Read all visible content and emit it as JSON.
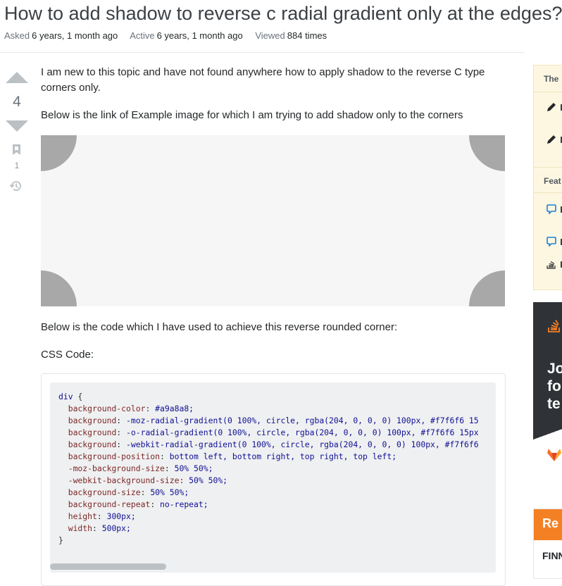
{
  "question": {
    "title": "How to add shadow to reverse c radial gradient only at the edges?",
    "asked_label": "Asked",
    "asked_value": "6 years, 1 month ago",
    "active_label": "Active",
    "active_value": "6 years, 1 month ago",
    "viewed_label": "Viewed",
    "viewed_value": "884 times"
  },
  "votes": {
    "score": "4",
    "bookmarks": "1"
  },
  "body": {
    "para1": "I am new to this topic and have not found anywhere how to apply shadow to the reverse C type corners only.",
    "para2": "Below is the link of Example image for which I am trying to add shadow only to the corners",
    "para3": "Below is the code which I have used to achieve this reverse rounded corner:",
    "para4": "CSS Code:"
  },
  "code_lines": [
    {
      "sel": "div",
      "tail": " {"
    },
    {
      "prop": "background-color",
      "val": "#a9a8a8;"
    },
    {
      "prop": "background",
      "val": "-moz-radial-gradient(0 100%, circle, rgba(204, 0, 0, 0) 100px, #f7f6f6 15"
    },
    {
      "prop": "background",
      "val": "-o-radial-gradient(0 100%, circle, rgba(204, 0, 0, 0) 100px, #f7f6f6 15px"
    },
    {
      "prop": "background",
      "val": "-webkit-radial-gradient(0 100%, circle, rgba(204, 0, 0, 0) 100px, #f7f6f6"
    },
    {
      "prop": "background-position",
      "val": "bottom left, bottom right, top right, top left;"
    },
    {
      "prop": "-moz-background-size",
      "val": "50% 50%;"
    },
    {
      "prop": "-webkit-background-size",
      "val": "50% 50%;"
    },
    {
      "prop": "background-size",
      "val": "50% 50%;"
    },
    {
      "prop": "background-repeat",
      "val": "no-repeat;"
    },
    {
      "prop": "height",
      "val": "300px;"
    },
    {
      "prop": "width",
      "val": "500px;"
    },
    {
      "close": "}"
    }
  ],
  "sidebar": {
    "blog_heading": "The ",
    "featured_heading": "Feat",
    "ad_text": "Jo\nfo\nte",
    "remote_title": "Re",
    "remote_sub": "FINN"
  },
  "colors": {
    "corner_gray": "#a9a8a8",
    "example_bg": "#f7f6f6",
    "vote_arrow": "#bbc0c4",
    "accent_orange": "#f48024"
  },
  "icons": [
    "vote-up-arrow",
    "vote-down-arrow",
    "bookmark-icon",
    "history-icon",
    "pencil-icon",
    "chat-icon",
    "stack-icon",
    "gitlab-icon"
  ]
}
